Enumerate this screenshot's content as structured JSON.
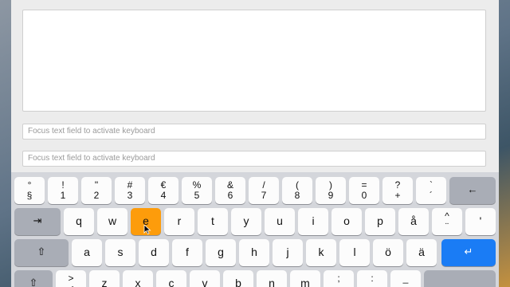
{
  "fields": {
    "placeholder1": "Focus text field to activate keyboard",
    "placeholder2": "Focus text field to activate keyboard"
  },
  "keyboard": {
    "row1": [
      {
        "t": "°",
        "b": "§"
      },
      {
        "t": "!",
        "b": "1"
      },
      {
        "t": "\"",
        "b": "2"
      },
      {
        "t": "#",
        "b": "3"
      },
      {
        "t": "€",
        "b": "4"
      },
      {
        "t": "%",
        "b": "5"
      },
      {
        "t": "&",
        "b": "6"
      },
      {
        "t": "/",
        "b": "7"
      },
      {
        "t": "(",
        "b": "8"
      },
      {
        "t": ")",
        "b": "9"
      },
      {
        "t": "=",
        "b": "0"
      },
      {
        "t": "?",
        "b": "+"
      },
      {
        "t": "`",
        "b": "´"
      }
    ],
    "backspace": "←",
    "tab": "⇥",
    "row2": [
      "q",
      "w",
      "e",
      "r",
      "t",
      "y",
      "u",
      "i",
      "o",
      "p",
      "å"
    ],
    "row2_extra": {
      "t": "^",
      "b": "¨"
    },
    "row2_last": "'",
    "shift": "⇧",
    "row3": [
      "a",
      "s",
      "d",
      "f",
      "g",
      "h",
      "j",
      "k",
      "l",
      "ö",
      "ä"
    ],
    "enter": "↵",
    "row4_first": {
      "t": ">",
      "b": "<"
    },
    "row4": [
      "z",
      "x",
      "c",
      "v",
      "b",
      "n",
      "m"
    ],
    "row4_punct": [
      {
        "t": ";",
        "b": ","
      },
      {
        "t": ":",
        "b": "."
      },
      {
        "t": "_",
        "b": "-"
      }
    ]
  },
  "colors": {
    "accent_key": "#fd9c0b",
    "enter_key": "#1a7cf5"
  }
}
